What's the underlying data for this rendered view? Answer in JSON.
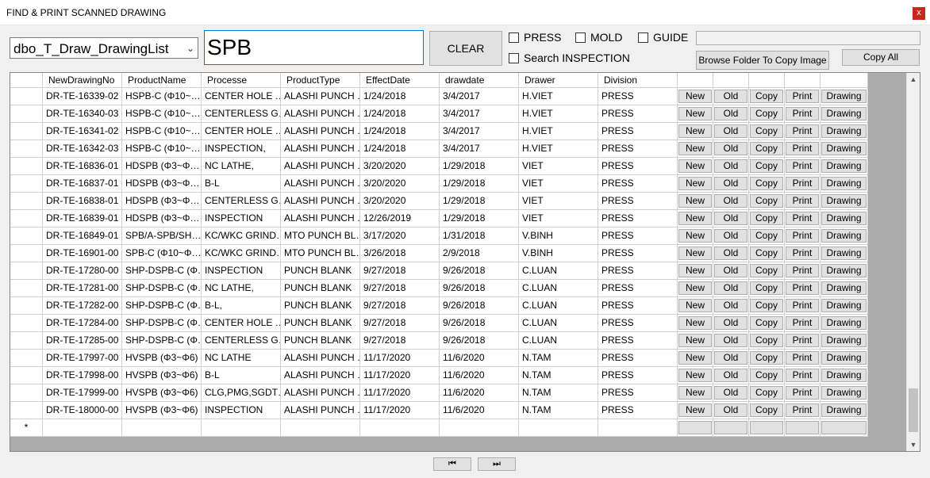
{
  "window": {
    "title": "FIND & PRINT SCANNED DRAWING",
    "close_label": "x"
  },
  "toolbar": {
    "table_select": "dbo_T_Draw_DrawingList",
    "search_value": "SPB",
    "clear_label": "CLEAR",
    "press_label": "PRESS",
    "mold_label": "MOLD",
    "guide_label": "GUIDE",
    "inspection_label": "Search INSPECTION",
    "folder_path": "",
    "browse_label": "Browse Folder To Copy Image",
    "copy_all_label": "Copy All"
  },
  "grid": {
    "columns": [
      "NewDrawingNo",
      "ProductName",
      "Processe",
      "ProductType",
      "EffectDate",
      "drawdate",
      "Drawer",
      "Division"
    ],
    "button_labels": [
      "New",
      "Old",
      "Copy",
      "Print",
      "Drawing"
    ],
    "new_row_marker": "*",
    "rows": [
      [
        "DR-TE-16339-02",
        "HSPB-C (Φ10~…",
        "CENTER HOLE …",
        "ALASHI PUNCH …",
        "1/24/2018",
        "3/4/2017",
        "H.VIET",
        "PRESS"
      ],
      [
        "DR-TE-16340-03",
        "HSPB-C (Φ10~…",
        "CENTERLESS G…",
        "ALASHI PUNCH …",
        "1/24/2018",
        "3/4/2017",
        "H.VIET",
        "PRESS"
      ],
      [
        "DR-TE-16341-02",
        "HSPB-C (Φ10~…",
        "CENTER HOLE …",
        "ALASHI PUNCH …",
        "1/24/2018",
        "3/4/2017",
        "H.VIET",
        "PRESS"
      ],
      [
        "DR-TE-16342-03",
        "HSPB-C (Φ10~…",
        "INSPECTION,",
        "ALASHI PUNCH …",
        "1/24/2018",
        "3/4/2017",
        "H.VIET",
        "PRESS"
      ],
      [
        "DR-TE-16836-01",
        "HDSPB (Φ3~Φ…",
        "NC LATHE,",
        "ALASHI PUNCH …",
        "3/20/2020",
        "1/29/2018",
        "VIET",
        "PRESS"
      ],
      [
        "DR-TE-16837-01",
        "HDSPB (Φ3~Φ…",
        "B-L",
        "ALASHI PUNCH …",
        "3/20/2020",
        "1/29/2018",
        "VIET",
        "PRESS"
      ],
      [
        "DR-TE-16838-01",
        "HDSPB (Φ3~Φ…",
        "CENTERLESS G…",
        "ALASHI PUNCH …",
        "3/20/2020",
        "1/29/2018",
        "VIET",
        "PRESS"
      ],
      [
        "DR-TE-16839-01",
        "HDSPB (Φ3~Φ…",
        "INSPECTION",
        "ALASHI PUNCH …",
        "12/26/2019",
        "1/29/2018",
        "VIET",
        "PRESS"
      ],
      [
        "DR-TE-16849-01",
        "SPB/A-SPB/SH…",
        "KC/WKC GRIND…",
        "MTO PUNCH BL…",
        "3/17/2020",
        "1/31/2018",
        "V.BINH",
        "PRESS"
      ],
      [
        "DR-TE-16901-00",
        "SPB-C (Φ10~Φ…",
        "KC/WKC GRIND…",
        "MTO PUNCH BL…",
        "3/26/2018",
        "2/9/2018",
        "V.BINH",
        "PRESS"
      ],
      [
        "DR-TE-17280-00",
        "SHP-DSPB-C (Φ…",
        "INSPECTION",
        "PUNCH BLANK",
        "9/27/2018",
        "9/26/2018",
        "C.LUAN",
        "PRESS"
      ],
      [
        "DR-TE-17281-00",
        "SHP-DSPB-C (Φ…",
        "NC LATHE,",
        "PUNCH BLANK",
        "9/27/2018",
        "9/26/2018",
        "C.LUAN",
        "PRESS"
      ],
      [
        "DR-TE-17282-00",
        "SHP-DSPB-C (Φ…",
        "B-L,",
        "PUNCH BLANK",
        "9/27/2018",
        "9/26/2018",
        "C.LUAN",
        "PRESS"
      ],
      [
        "DR-TE-17284-00",
        "SHP-DSPB-C (Φ…",
        "CENTER HOLE …",
        "PUNCH BLANK",
        "9/27/2018",
        "9/26/2018",
        "C.LUAN",
        "PRESS"
      ],
      [
        "DR-TE-17285-00",
        "SHP-DSPB-C (Φ…",
        "CENTERLESS G…",
        "PUNCH BLANK",
        "9/27/2018",
        "9/26/2018",
        "C.LUAN",
        "PRESS"
      ],
      [
        "DR-TE-17997-00",
        "HVSPB (Φ3~Φ6)",
        "NC LATHE",
        "ALASHI PUNCH …",
        "11/17/2020",
        "11/6/2020",
        "N.TAM",
        "PRESS"
      ],
      [
        "DR-TE-17998-00",
        "HVSPB (Φ3~Φ6)",
        "B-L",
        "ALASHI PUNCH …",
        "11/17/2020",
        "11/6/2020",
        "N.TAM",
        "PRESS"
      ],
      [
        "DR-TE-17999-00",
        "HVSPB (Φ3~Φ6)",
        "CLG,PMG,SGDT…",
        "ALASHI PUNCH …",
        "11/17/2020",
        "11/6/2020",
        "N.TAM",
        "PRESS"
      ],
      [
        "DR-TE-18000-00",
        "HVSPB (Φ3~Φ6)",
        "INSPECTION",
        "ALASHI PUNCH …",
        "11/17/2020",
        "11/6/2020",
        "N.TAM",
        "PRESS"
      ]
    ]
  },
  "nav": {
    "first_label": "⏮",
    "last_label": "⏭"
  }
}
